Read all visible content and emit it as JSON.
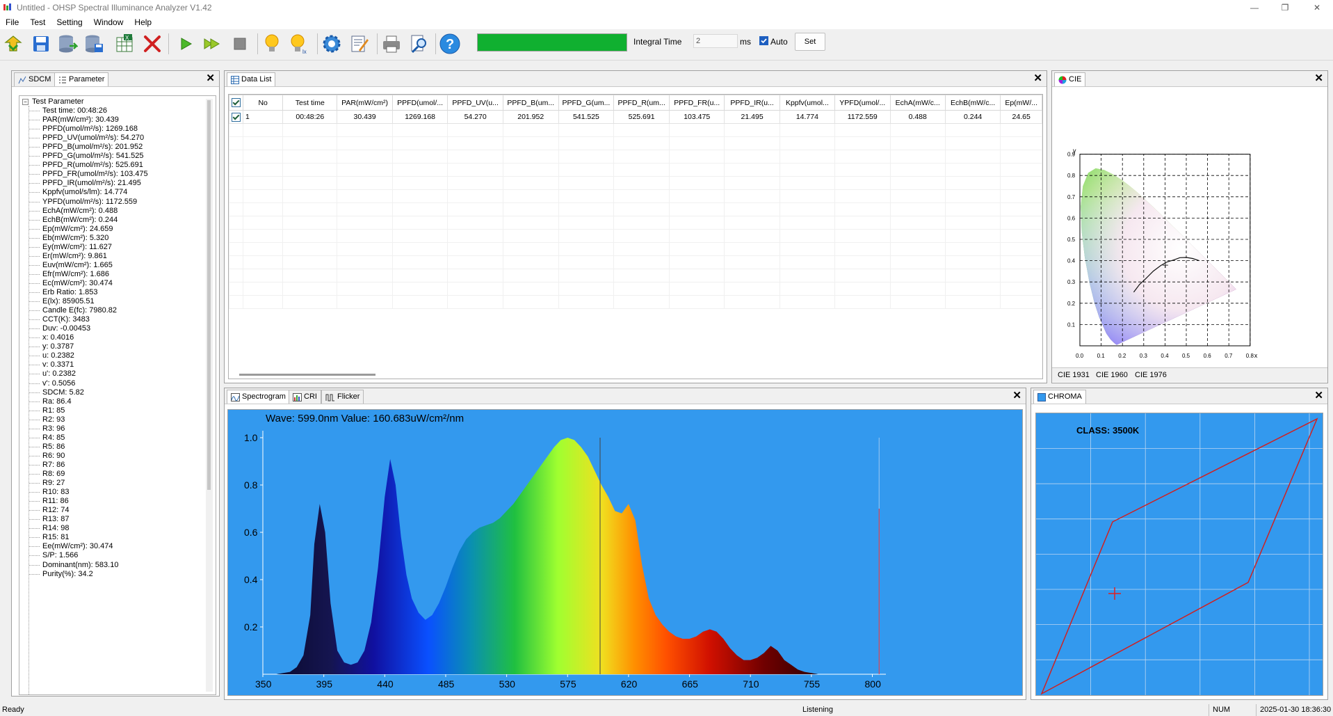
{
  "window": {
    "title": "Untitled - OHSP Spectral Illuminance Analyzer V1.42",
    "minimize": "—",
    "restore": "❐",
    "close": "✕"
  },
  "menu": [
    "File",
    "Test",
    "Setting",
    "Window",
    "Help"
  ],
  "toolbar": {
    "icons": [
      "open-icon",
      "save-icon",
      "database-export-icon",
      "database-save-icon",
      "excel-export-icon",
      "delete-icon",
      "play-icon",
      "play-continuous-icon",
      "stop-icon",
      "bulb-icon",
      "bulb-lx-icon",
      "settings-gear-icon",
      "edit-icon",
      "print-icon",
      "print-preview-icon",
      "help-icon"
    ],
    "progress_fraction": 1.0,
    "progress_color": "#10b030",
    "integral_time_label": "Integral Time",
    "integral_time_value": "2",
    "integral_time_unit": "ms",
    "auto_label": "Auto",
    "auto_checked": true,
    "set_label": "Set"
  },
  "left_panel": {
    "tabs": [
      "SDCM",
      "Parameter"
    ],
    "active_tab": "Parameter",
    "root": "Test Parameter",
    "items": [
      "Test time: 00:48:26",
      "PAR(mW/cm²): 30.439",
      "PPFD(umol/m²/s): 1269.168",
      "PPFD_UV(umol/m²/s): 54.270",
      "PPFD_B(umol/m²/s): 201.952",
      "PPFD_G(umol/m²/s): 541.525",
      "PPFD_R(umol/m²/s): 525.691",
      "PPFD_FR(umol/m²/s): 103.475",
      "PPFD_IR(umol/m²/s): 21.495",
      "Kppfv(umol/s/lm): 14.774",
      "YPFD(umol/m²/s): 1172.559",
      "EchA(mW/cm²): 0.488",
      "EchB(mW/cm²): 0.244",
      "Ep(mW/cm²): 24.659",
      "Eb(mW/cm²): 5.320",
      "Ey(mW/cm²): 11.627",
      "Er(mW/cm²): 9.861",
      "Euv(mW/cm²): 1.665",
      "Efr(mW/cm²): 1.686",
      "Ec(mW/cm²): 30.474",
      "Erb Ratio: 1.853",
      "E(lx): 85905.51",
      "Candle E(fc): 7980.82",
      "CCT(K): 3483",
      "Duv: -0.00453",
      "x: 0.4016",
      "y: 0.3787",
      "u: 0.2382",
      "v: 0.3371",
      "u': 0.2382",
      "v': 0.5056",
      "SDCM: 5.82",
      "Ra: 86.4",
      "R1: 85",
      "R2: 93",
      "R3: 96",
      "R4: 85",
      "R5: 86",
      "R6: 90",
      "R7: 86",
      "R8: 69",
      "R9: 27",
      "R10: 83",
      "R11: 86",
      "R12: 74",
      "R13: 87",
      "R14: 98",
      "R15: 81",
      "Ee(mW/cm²): 30.474",
      "S/P: 1.566",
      "Dominant(nm): 583.10",
      "Purity(%): 34.2"
    ]
  },
  "data_list": {
    "tab": "Data List",
    "columns": [
      "No",
      "Test time",
      "PAR(mW/cm²)",
      "PPFD(umol/...",
      "PPFD_UV(u...",
      "PPFD_B(um...",
      "PPFD_G(um...",
      "PPFD_R(um...",
      "PPFD_FR(u...",
      "PPFD_IR(u...",
      "Kppfv(umol...",
      "YPFD(umol/...",
      "EchA(mW/c...",
      "EchB(mW/c...",
      "Ep(mW/..."
    ],
    "rows": [
      [
        "1",
        "00:48:26",
        "30.439",
        "1269.168",
        "54.270",
        "201.952",
        "541.525",
        "525.691",
        "103.475",
        "21.495",
        "14.774",
        "1172.559",
        "0.488",
        "0.244",
        "24.65"
      ]
    ]
  },
  "cie": {
    "tab": "CIE",
    "tabs_bottom": [
      "CIE 1931",
      "CIE 1960",
      "CIE 1976"
    ],
    "axis_y": "y",
    "axis_x": "x",
    "x_ticks": [
      "0.0",
      "0.1",
      "0.2",
      "0.3",
      "0.4",
      "0.5",
      "0.6",
      "0.7",
      "0.8"
    ],
    "y_ticks": [
      "0.1",
      "0.2",
      "0.3",
      "0.4",
      "0.5",
      "0.6",
      "0.7",
      "0.8",
      "0.9"
    ],
    "point": {
      "x": 0.4016,
      "y": 0.3787
    }
  },
  "spectrogram": {
    "tabs": [
      "Spectrogram",
      "CRI",
      "Flicker"
    ],
    "readout": "Wave: 599.0nm Value: 160.683uW/cm²/nm",
    "background": "#3399ee"
  },
  "chroma": {
    "tab": "CHROMA",
    "class_label": "CLASS: 3500K",
    "background": "#3399ee"
  },
  "status": {
    "left": "Ready",
    "middle": "Listening",
    "num": "NUM",
    "datetime": "2025-01-30 18:36:30"
  },
  "chart_data": {
    "type": "area",
    "title": "Wave: 599.0nm Value: 160.683uW/cm²/nm",
    "xlabel": "",
    "ylabel": "",
    "xlim": [
      350,
      810
    ],
    "ylim": [
      0,
      1.0
    ],
    "x_ticks": [
      350,
      395,
      440,
      485,
      530,
      575,
      620,
      665,
      710,
      755,
      800
    ],
    "y_ticks": [
      0.2,
      0.4,
      0.6,
      0.8,
      1.0
    ],
    "cursor_x": 599,
    "x": [
      360,
      365,
      370,
      375,
      380,
      385,
      388,
      392,
      396,
      400,
      405,
      410,
      415,
      420,
      425,
      430,
      435,
      440,
      444,
      448,
      452,
      456,
      460,
      465,
      470,
      475,
      480,
      485,
      490,
      495,
      500,
      505,
      510,
      515,
      520,
      525,
      530,
      535,
      540,
      545,
      550,
      555,
      560,
      565,
      570,
      575,
      580,
      585,
      590,
      595,
      600,
      605,
      610,
      615,
      620,
      625,
      630,
      635,
      640,
      645,
      650,
      655,
      660,
      665,
      670,
      675,
      680,
      685,
      690,
      695,
      700,
      705,
      710,
      715,
      720,
      725,
      730,
      735,
      740,
      745,
      750,
      755,
      760,
      765,
      770,
      775,
      780,
      785,
      790
    ],
    "values": [
      0.0,
      0.005,
      0.01,
      0.03,
      0.08,
      0.25,
      0.55,
      0.72,
      0.6,
      0.3,
      0.1,
      0.05,
      0.04,
      0.05,
      0.1,
      0.22,
      0.45,
      0.75,
      0.91,
      0.8,
      0.58,
      0.42,
      0.32,
      0.26,
      0.23,
      0.25,
      0.3,
      0.37,
      0.45,
      0.52,
      0.57,
      0.6,
      0.62,
      0.63,
      0.64,
      0.66,
      0.69,
      0.72,
      0.76,
      0.8,
      0.84,
      0.88,
      0.92,
      0.96,
      0.99,
      1.0,
      0.99,
      0.96,
      0.92,
      0.86,
      0.8,
      0.75,
      0.69,
      0.68,
      0.72,
      0.65,
      0.46,
      0.32,
      0.25,
      0.21,
      0.18,
      0.16,
      0.15,
      0.15,
      0.16,
      0.18,
      0.19,
      0.18,
      0.15,
      0.11,
      0.08,
      0.06,
      0.06,
      0.07,
      0.09,
      0.12,
      0.1,
      0.06,
      0.04,
      0.02,
      0.01,
      0.005,
      0.0
    ]
  },
  "cursor_line_color": "#444444",
  "limit_line_color": "#ff3333"
}
